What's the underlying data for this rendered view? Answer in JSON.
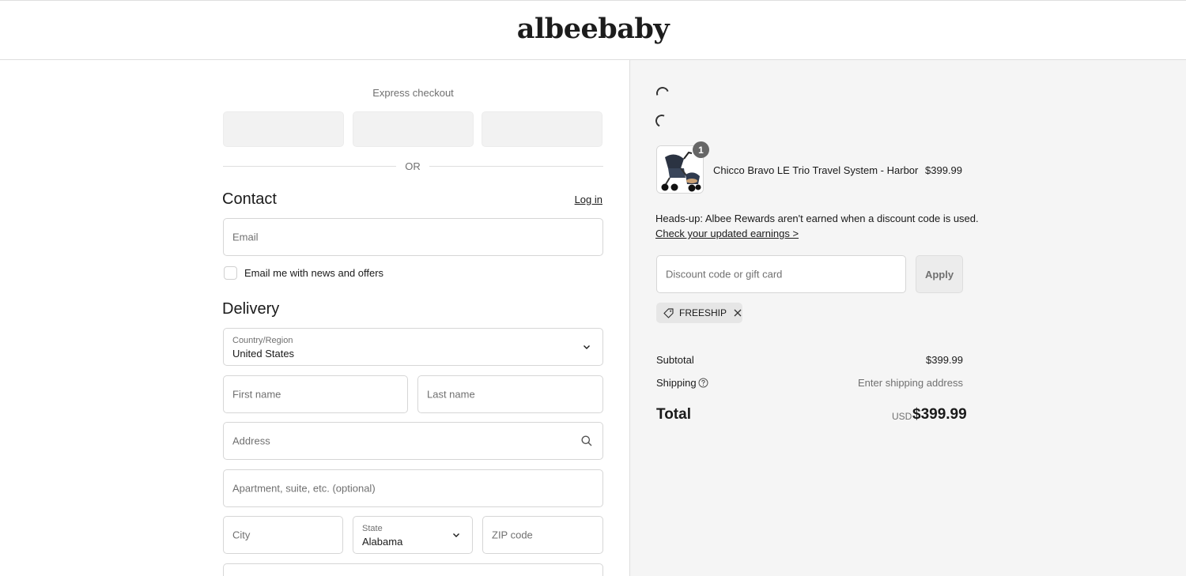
{
  "header": {
    "logo": "albeebaby"
  },
  "express": {
    "label": "Express checkout",
    "or": "OR"
  },
  "contact": {
    "title": "Contact",
    "login": "Log in",
    "email_placeholder": "Email",
    "newsletter_label": "Email me with news and offers",
    "newsletter_checked": false
  },
  "delivery": {
    "title": "Delivery",
    "country_label": "Country/Region",
    "country_value": "United States",
    "first_name": "First name",
    "last_name": "Last name",
    "address": "Address",
    "apartment": "Apartment, suite, etc. (optional)",
    "city": "City",
    "state_label": "State",
    "state_value": "Alabama",
    "zip": "ZIP code"
  },
  "order": {
    "item": {
      "name": "Chicco Bravo LE Trio Travel System - Harbor",
      "price": "$399.99",
      "quantity": "1"
    },
    "notice": "Heads-up: Albee Rewards aren't earned when a discount code is used.",
    "notice_link": "Check your updated earnings >",
    "discount_placeholder": "Discount code or gift card",
    "apply": "Apply",
    "applied_code": "FREESHIP",
    "subtotal_label": "Subtotal",
    "subtotal_value": "$399.99",
    "shipping_label": "Shipping",
    "shipping_value": "Enter shipping address",
    "total_label": "Total",
    "total_currency": "USD",
    "total_value": "$399.99"
  },
  "colors": {
    "right_pane_bg": "#f5f5f5",
    "border": "#d6d6d6",
    "muted_text": "#707070",
    "badge_bg": "#666666"
  }
}
